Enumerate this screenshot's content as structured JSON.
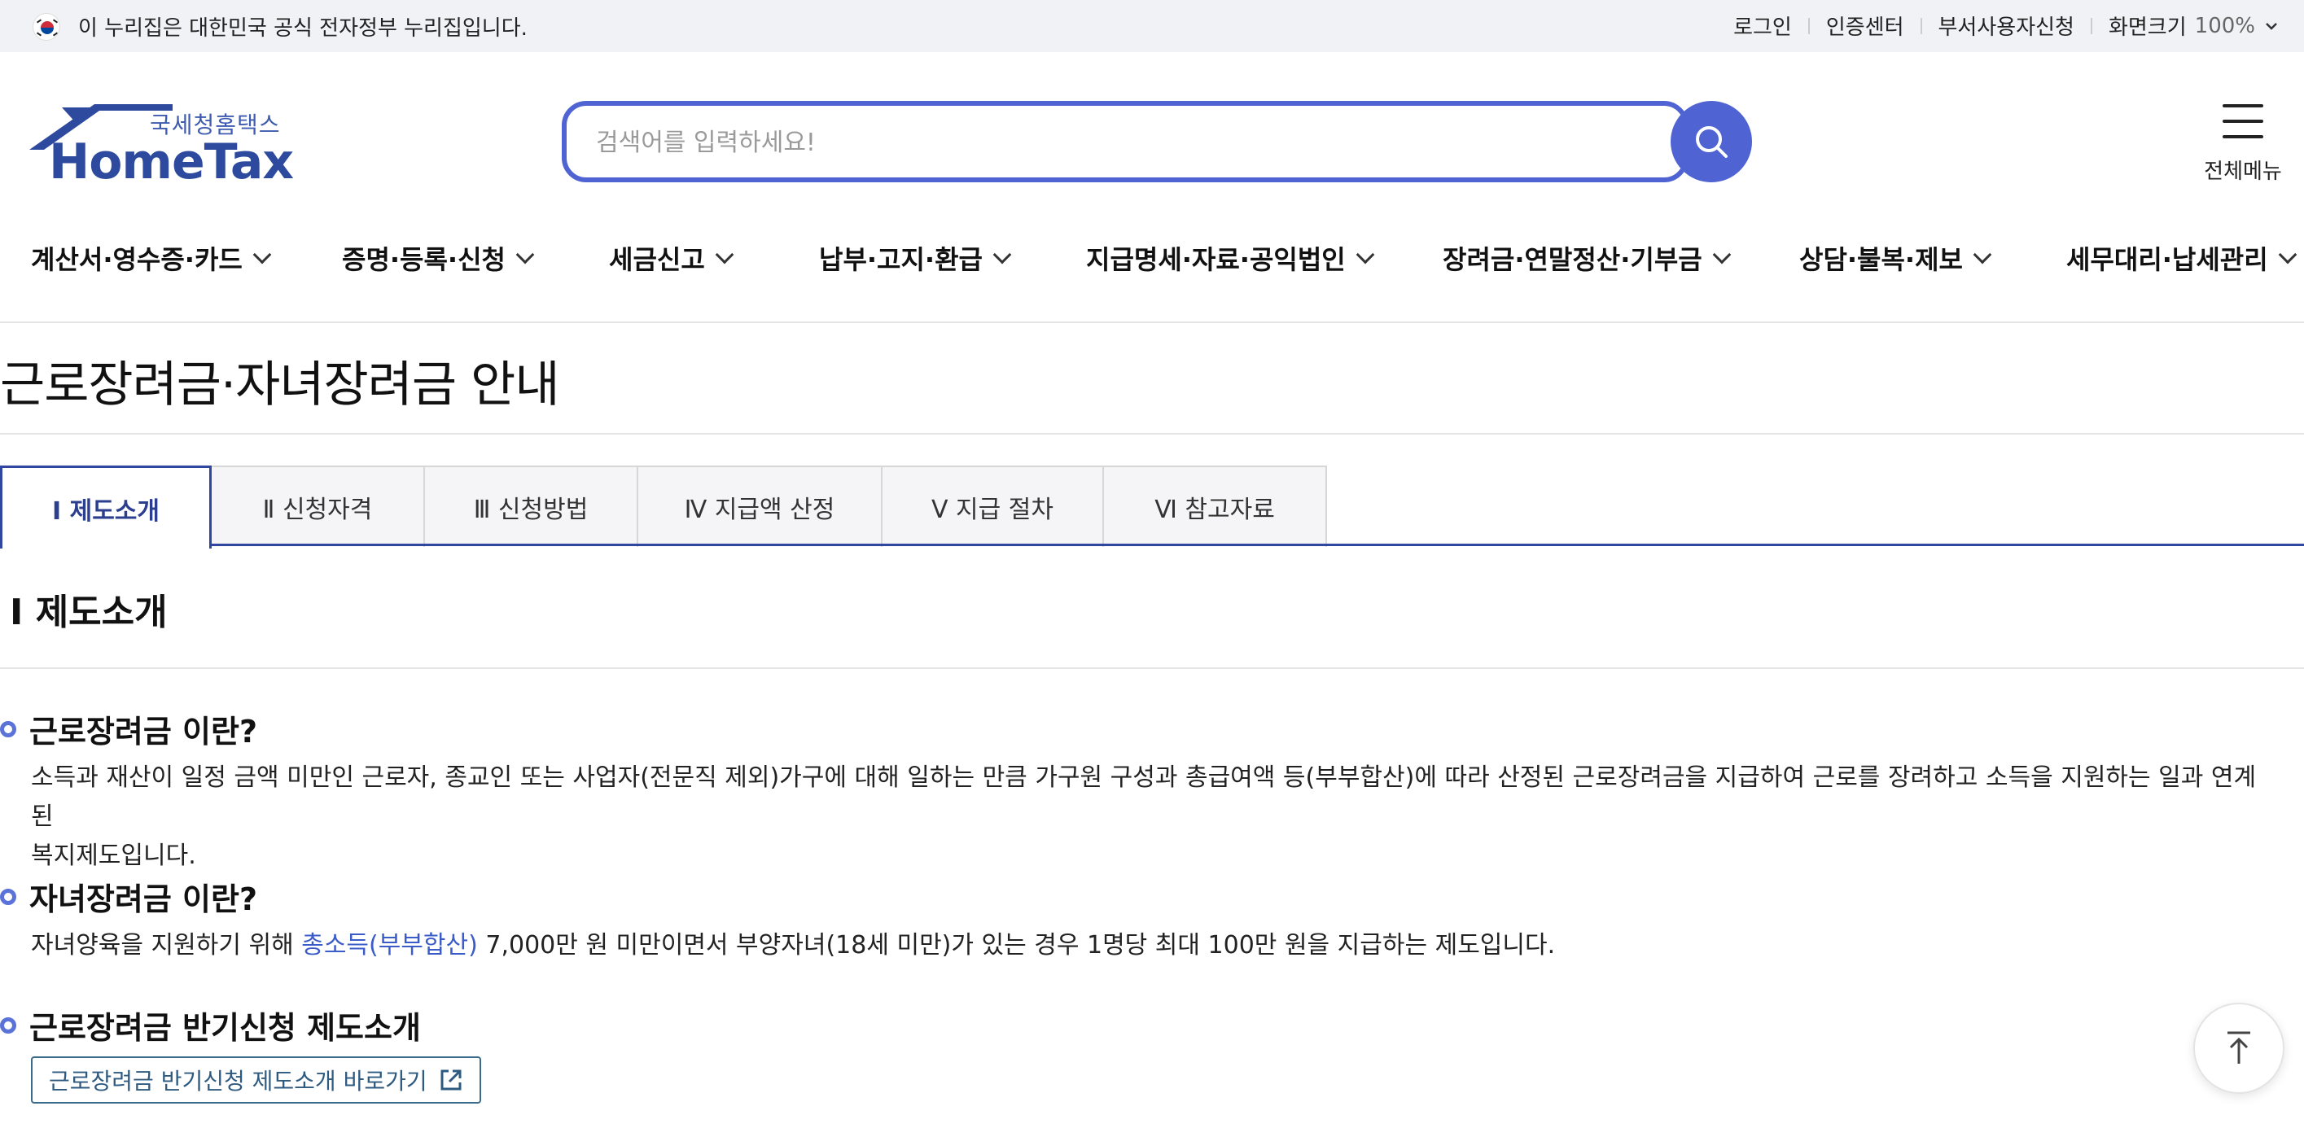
{
  "govbar": {
    "notice": "이 누리집은 대한민국 공식 전자정부 누리집입니다.",
    "links": [
      "로그인",
      "인증센터",
      "부서사용자신청"
    ],
    "zoom_label": "화면크기",
    "zoom_value": "100%"
  },
  "header": {
    "logo_sub": "국세청홈택스",
    "logo_main": "HomeTax",
    "search_placeholder": "검색어를 입력하세요!",
    "all_menu_label": "전체메뉴"
  },
  "gnb": [
    "계산서·영수증·카드",
    "증명·등록·신청",
    "세금신고",
    "납부·고지·환급",
    "지급명세·자료·공익법인",
    "장려금·연말정산·기부금",
    "상담·불복·제보",
    "세무대리·납세관리"
  ],
  "page": {
    "title": "근로장려금·자녀장려금 안내",
    "tabs": [
      "Ⅰ 제도소개",
      "Ⅱ 신청자격",
      "Ⅲ 신청방법",
      "Ⅳ 지급액 산정",
      "Ⅴ 지급 절차",
      "Ⅵ 참고자료"
    ],
    "active_tab": 0
  },
  "content": {
    "section_title": "Ⅰ 제도소개",
    "h1": "근로장려금 이란?",
    "p1_line1": "소득과 재산이 일정 금액 미만인 근로자, 종교인 또는 사업자(전문직 제외)가구에 대해 일하는 만큼 가구원 구성과 총급여액 등(부부합산)에 따라 산정된 근로장려금을 지급하여 근로를 장려하고 소득을 지원하는 일과 연계된",
    "p1_line2": "복지제도입니다.",
    "h2": "자녀장려금 이란?",
    "p2_before": "자녀양육을 지원하기 위해 ",
    "p2_highlight": "총소득(부부합산)",
    "p2_after": " 7,000만 원 미만이면서 부양자녀(18세 미만)가 있는 경우 1명당 최대 100만 원을 지급하는 제도입니다.",
    "h3": "근로장려금 반기신청 제도소개",
    "link_button": "근로장려금 반기신청 제도소개 바로가기"
  },
  "colors": {
    "accent": "#4f63d2",
    "tab_active": "#3046a0",
    "highlight_text": "#3a5cc9"
  }
}
